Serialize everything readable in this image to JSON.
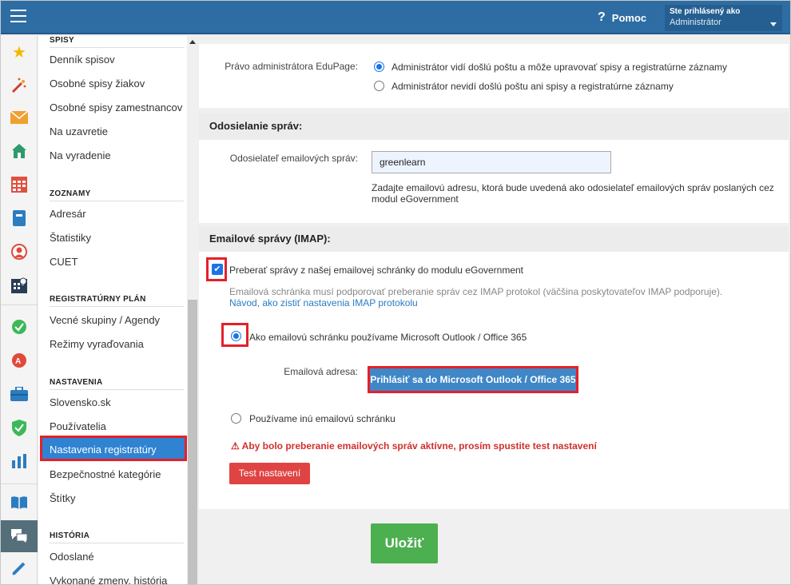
{
  "header": {
    "help_label": "Pomoc",
    "user_line1": "Ste prihlásený ako",
    "user_line2": "Administrátor"
  },
  "rail_icons": [
    "star-icon",
    "magic-wand-icon",
    "mail-icon",
    "home-icon",
    "calendar-icon",
    "notebook-icon",
    "person-icon",
    "schedule-icon",
    "check-icon",
    "grade-icon",
    "briefcase-icon",
    "shield-icon",
    "chart-icon",
    "book-icon",
    "chat-icon",
    "pencil-icon"
  ],
  "menu": {
    "sections": {
      "spisy": "SPISY",
      "zoznamy": "ZOZNAMY",
      "plan": "REGISTRATÚRNY PLÁN",
      "nastavenia": "NASTAVENIA",
      "historia": "HISTÓRIA"
    },
    "items": {
      "dennik": "Denník spisov",
      "ziakov": "Osobné spisy žiakov",
      "zamestnancov": "Osobné spisy zamestnancov",
      "uzavretie": "Na uzavretie",
      "vyradenie": "Na vyradenie",
      "adresar": "Adresár",
      "statistiky": "Štatistiky",
      "cuet": "CUET",
      "vecne": "Vecné skupiny / Agendy",
      "rezimy": "Režimy vyraďovania",
      "slovensko": "Slovensko.sk",
      "pouzivatelia": "Používatelia",
      "nastavenia_reg": "Nastavenia registratúry",
      "bezpecnostne": "Bezpečnostné kategórie",
      "stitky": "Štítky",
      "odoslane": "Odoslané",
      "vykonane": "Vykonané zmeny, história"
    }
  },
  "main": {
    "pravo_label": "Právo administrátora EduPage:",
    "pravo_opt1": "Administrátor vidí došlú poštu a môže upravovať spisy a registratúrne záznamy",
    "pravo_opt2": "Administrátor nevidí došlú poštu ani spisy a registratúrne záznamy",
    "sending_head": "Odosielanie správ:",
    "sender_label": "Odosielateľ emailových správ:",
    "sender_value": "greenlearn",
    "sender_hint1": "Zadajte emailovú adresu, ktorá bude uvedená ako odosielateľ emailových správ poslaných cez",
    "sender_hint2": "modul eGovernment",
    "imap_head": "Emailové správy (IMAP):",
    "imap_check": "Preberať správy z našej emailovej schránky do modulu eGovernment",
    "imap_note": "Emailová schránka musí podporovať preberanie správ cez IMAP protokol (väčšina poskytovateľov IMAP podporuje).",
    "imap_link": "Návod, ako zistiť nastavenia IMAP protokolu",
    "outlook_radio": "Ako emailovú schránku používame Microsoft Outlook / Office 365",
    "email_label": "Emailová adresa:",
    "ms_button": "Prihlásiť sa do Microsoft Outlook / Office 365",
    "other_radio": "Používame inú emailovú schránku",
    "warning": "Aby bolo preberanie emailových správ aktívne, prosím spustite test nastavení",
    "test_button": "Test nastavení",
    "save_button": "Uložiť"
  }
}
